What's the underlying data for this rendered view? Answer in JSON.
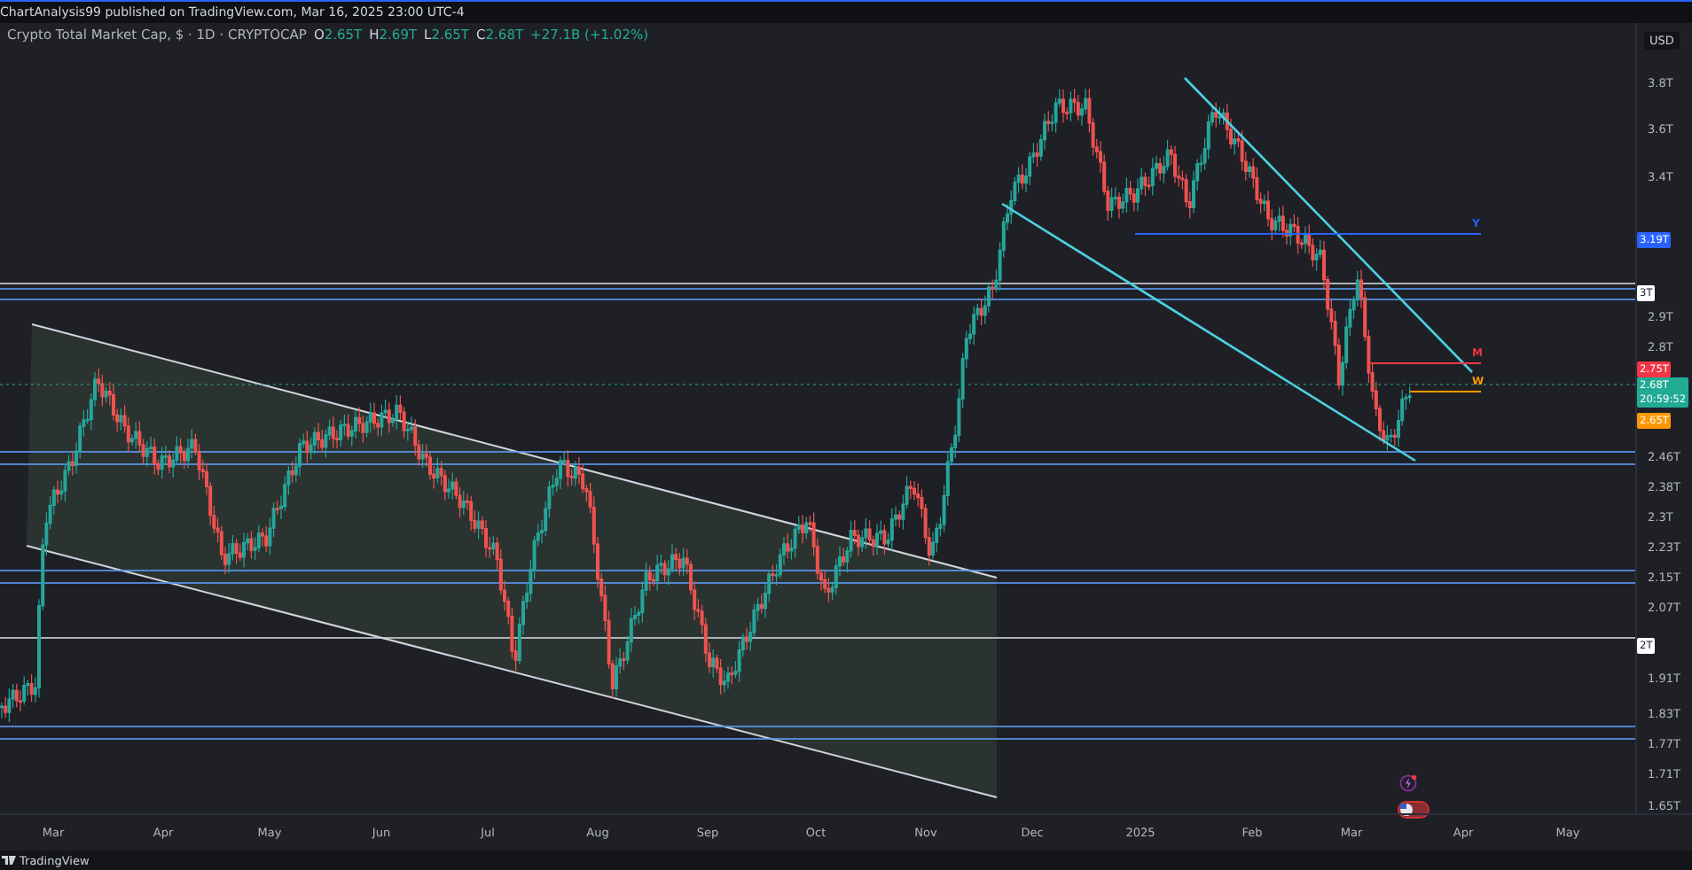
{
  "header": {
    "publisher_line": "ChartAnalysis99 published on TradingView.com, Mar 16, 2025 23:00 UTC-4"
  },
  "legend": {
    "symbol": "Crypto Total Market Cap, $ · 1D · CRYPTOCAP",
    "values": [
      {
        "label": "O",
        "value": "2.65T"
      },
      {
        "label": "H",
        "value": "2.69T"
      },
      {
        "label": "L",
        "value": "2.65T"
      },
      {
        "label": "C",
        "value": "2.68T"
      }
    ],
    "change": "+27.1B (+1.02%)"
  },
  "drawing_labels": [
    {
      "text": "Y",
      "color": "#2962ff"
    },
    {
      "text": "M",
      "color": "#f23645"
    },
    {
      "text": "W",
      "color": "#ff9800"
    }
  ],
  "price_axis": {
    "currency": "USD",
    "ticks": [
      "3.8T",
      "3.6T",
      "3.4T",
      "2.9T",
      "2.8T",
      "2.46T",
      "2.38T",
      "2.3T",
      "2.23T",
      "2.15T",
      "2.07T",
      "1.91T",
      "1.83T",
      "1.77T",
      "1.71T",
      "1.65T"
    ],
    "tags": [
      {
        "text": "3.19T",
        "color": "#2962ff"
      },
      {
        "text": "3T",
        "color": "#ffffff"
      },
      {
        "text": "2.75T",
        "color": "#f23645"
      },
      {
        "text": "2.68T",
        "subtext": "20:59:52",
        "color": "#22ab94"
      },
      {
        "text": "2.65T",
        "color": "#ff9800"
      },
      {
        "text": "2T",
        "color": "#ffffff"
      }
    ]
  },
  "time_axis": {
    "labels": [
      "Mar",
      "Apr",
      "May",
      "Jun",
      "Jul",
      "Aug",
      "Sep",
      "Oct",
      "Nov",
      "Dec",
      "2025",
      "Feb",
      "Mar",
      "Apr",
      "May"
    ]
  },
  "footer": {
    "brand": "TradingView"
  }
}
